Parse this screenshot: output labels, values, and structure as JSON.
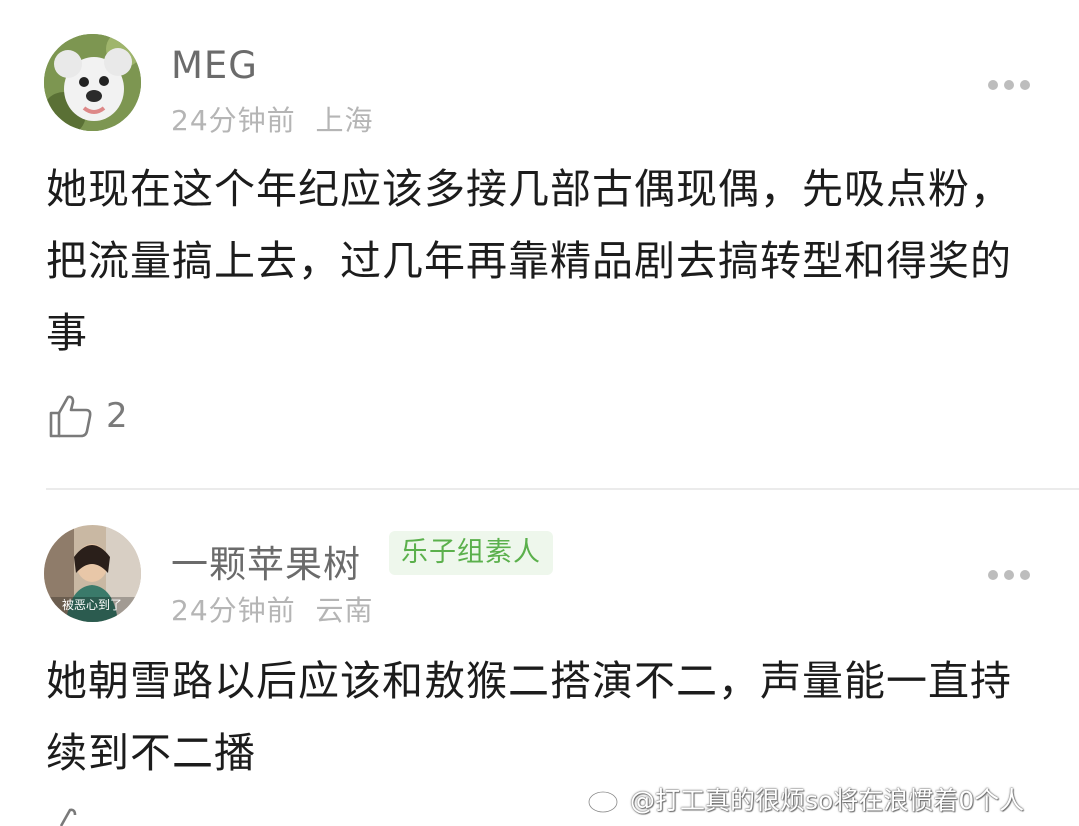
{
  "comments": [
    {
      "username": "MEG",
      "time": "24分钟前",
      "location": "上海",
      "badge": "",
      "text": "她现在这个年纪应该多接几部古偶现偶，先吸点粉，把流量搞上去，过几年再靠精品剧去搞转型和得奖的事",
      "likes": "2",
      "avatar_icon": "koala-avatar"
    },
    {
      "username": "一颗苹果树",
      "time": "24分钟前",
      "location": "云南",
      "badge": "乐子组素人",
      "text": "她朝雪路以后应该和敖猴二搭演不二，声量能一直持续到不二播",
      "avatar_icon": "photo-avatar",
      "avatar_caption": "被恶心到了"
    }
  ],
  "watermark": "@打工真的很烦so将在浪惯着0个人",
  "colors": {
    "badge_text": "#5bb04c",
    "badge_bg": "#eef7ec",
    "meta_text": "#b5b5b5",
    "username_text": "#6b6b6b"
  }
}
